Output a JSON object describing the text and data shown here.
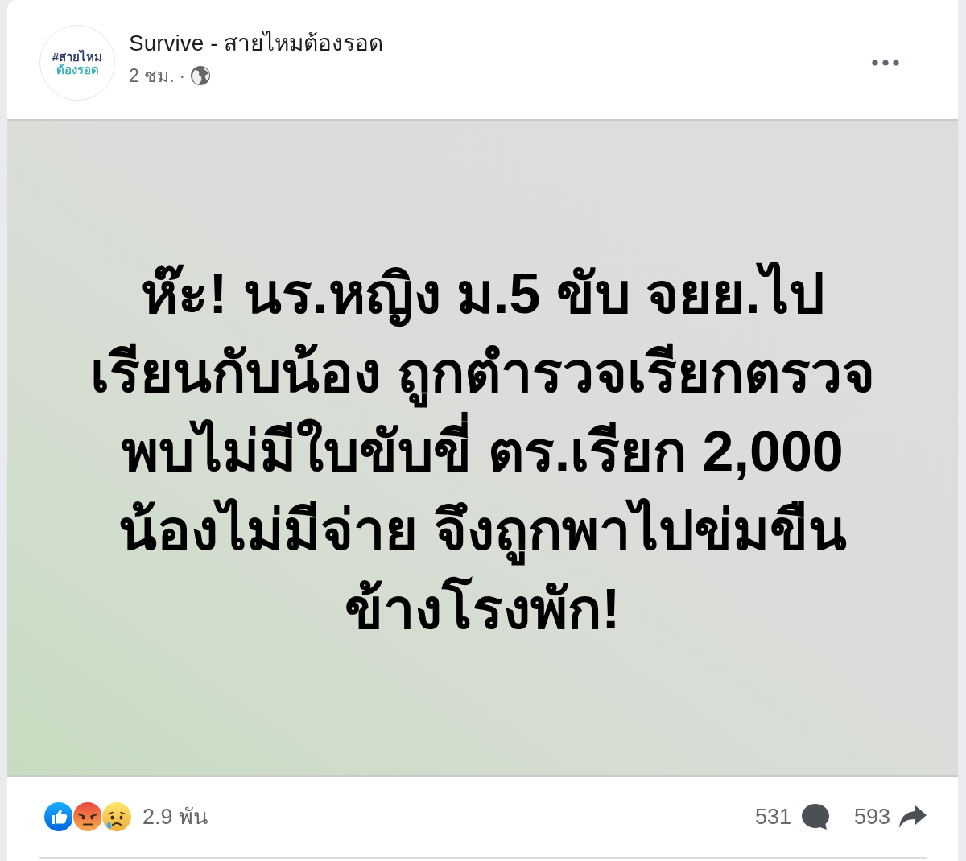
{
  "post": {
    "page_name": "Survive - สายไหมต้องรอด",
    "avatar_text": [
      "#สายไหม",
      "ต้องรอด"
    ],
    "time": "2 ชม.",
    "separator": "·"
  },
  "message": {
    "lines": [
      "ห๊ะ! นร.หญิง ม.5 ขับ จยย.ไป",
      "เรียนกับน้อง ถูกตำรวจเรียกตรวจ",
      "พบไม่มีใบขับขี่ ตร.เรียก 2,000",
      "น้องไม่มีจ่าย จึงถูกพาไปข่มขืน",
      "ข้างโรงพัก!"
    ]
  },
  "reactions": {
    "icons": [
      {
        "kind": "like"
      },
      {
        "kind": "angry"
      },
      {
        "kind": "sad"
      }
    ],
    "count": "2.9 พัน"
  },
  "stats": {
    "comments": "531",
    "shares": "593"
  }
}
